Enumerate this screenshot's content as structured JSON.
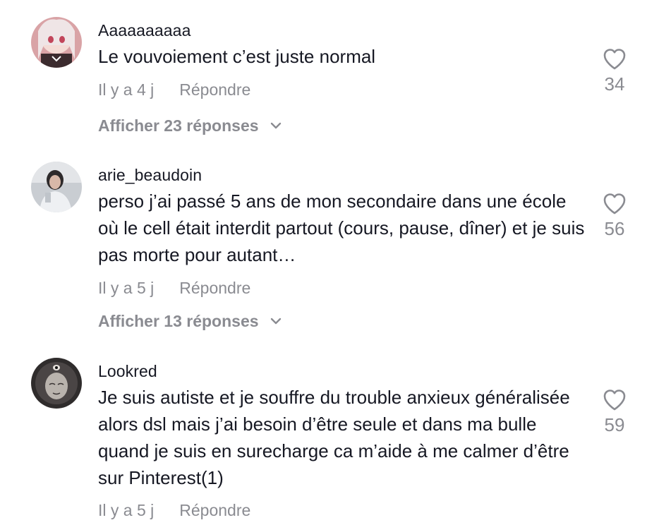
{
  "comments": [
    {
      "username": "Aaaaaaaaaa",
      "text": "Le vouvoiement c’est juste normal",
      "time": "Il y a 4 j",
      "reply_label": "Répondre",
      "likes": "34",
      "view_replies": "Afficher 23 réponses"
    },
    {
      "username": "arie_beaudoin",
      "text": "perso j’ai passé 5 ans de mon secondaire dans une école où le cell était interdit partout (cours, pause, dîner) et je suis pas morte pour autant…",
      "time": "Il y a 5 j",
      "reply_label": "Répondre",
      "likes": "56",
      "view_replies": "Afficher 13 réponses"
    },
    {
      "username": "Lookred",
      "text": "Je suis autiste et je souffre du trouble anxieux généralisée alors dsl mais j’ai besoin d’être seule et dans ma bulle quand je suis en surecharge ca m’aide à me calmer d’être sur Pinterest(1)",
      "time": "Il y a 5 j",
      "reply_label": "Répondre",
      "likes": "59"
    }
  ],
  "icons": {
    "like": "heart-outline-icon",
    "expand": "chevron-down-icon"
  },
  "colors": {
    "text_primary": "#161823",
    "text_secondary": "#8a8b91",
    "background": "#ffffff"
  }
}
